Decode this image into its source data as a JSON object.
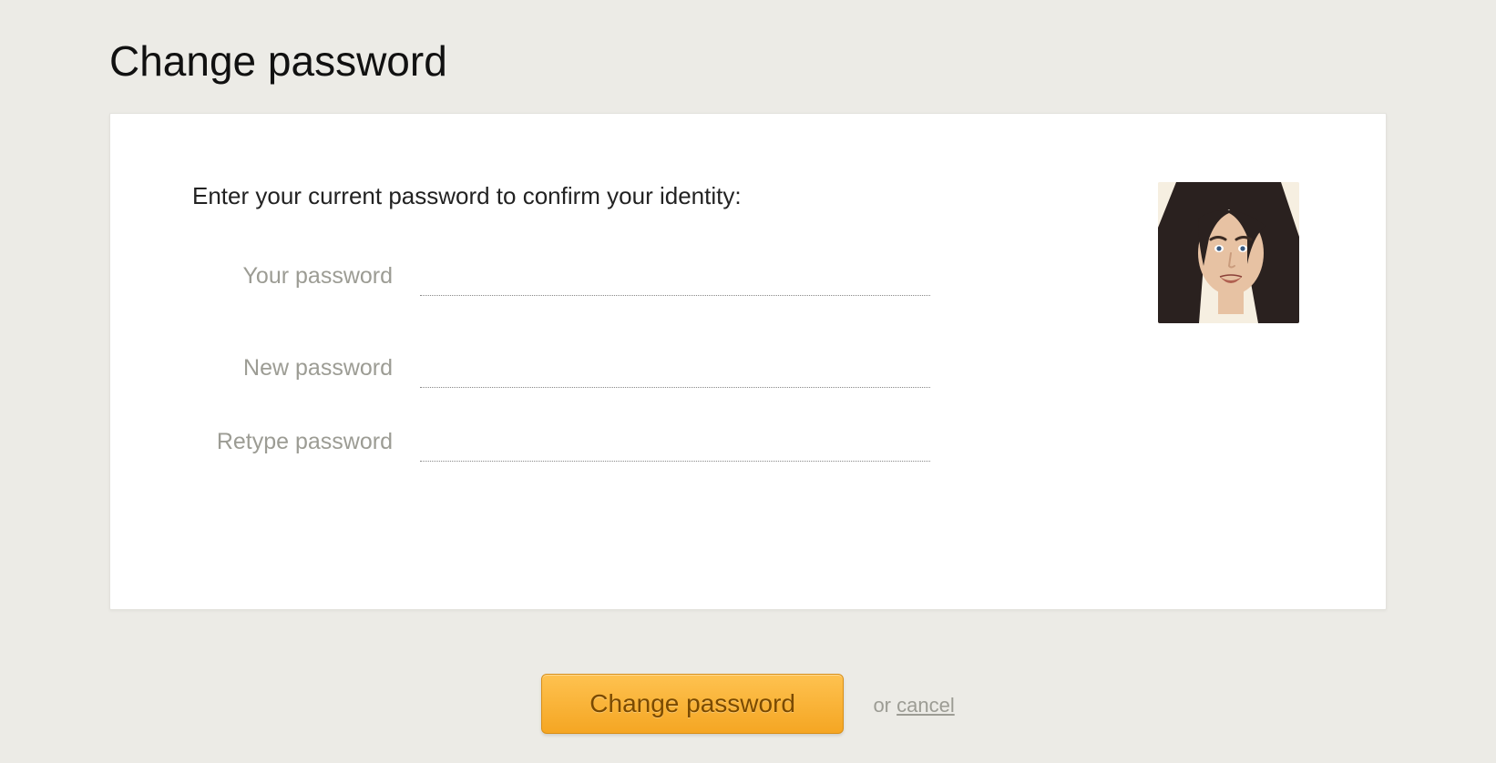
{
  "page": {
    "title": "Change password"
  },
  "form": {
    "instruction": "Enter your current password to confirm your identity:",
    "labels": {
      "current": "Your password",
      "new": "New password",
      "retype": "Retype password"
    },
    "values": {
      "current": "",
      "new": "",
      "retype": ""
    }
  },
  "actions": {
    "submit_label": "Change password",
    "or_text": "or ",
    "cancel_label": "cancel"
  },
  "colors": {
    "accent_top": "#fec250",
    "accent_bottom": "#f5a623",
    "page_bg": "#ecebe6"
  }
}
